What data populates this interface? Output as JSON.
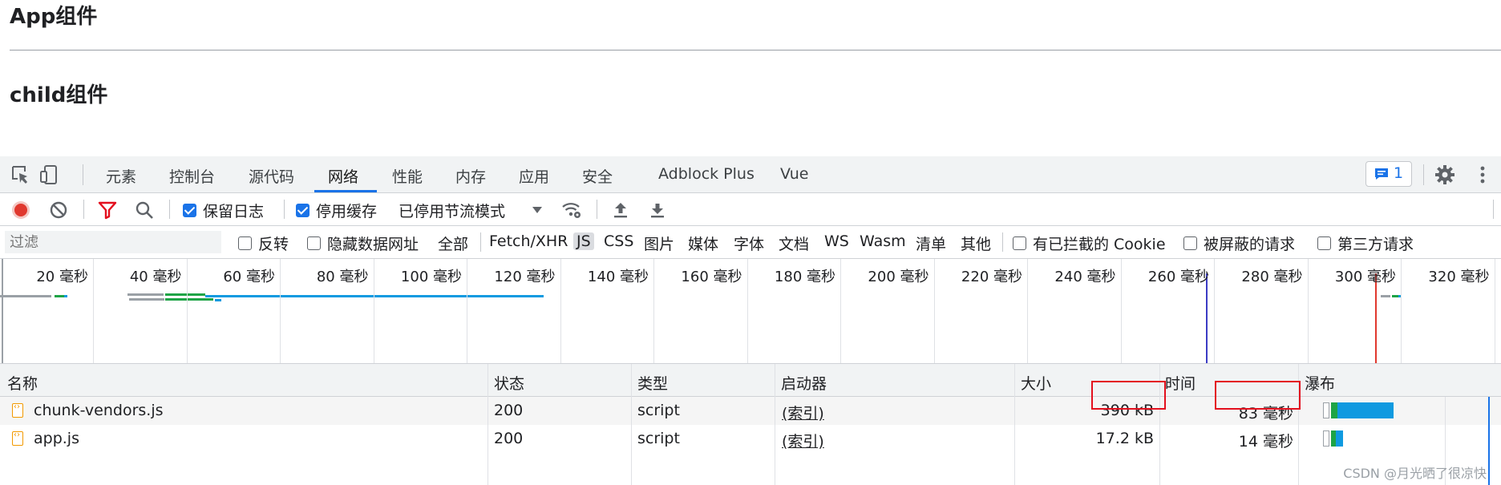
{
  "page": {
    "app_heading": "App组件",
    "child_heading": "child组件"
  },
  "devtools": {
    "tabs": [
      "元素",
      "控制台",
      "源代码",
      "网络",
      "性能",
      "内存",
      "应用",
      "安全",
      "Adblock Plus",
      "Vue"
    ],
    "active_tab": "网络",
    "issues_count": "1",
    "toolbar": {
      "preserve_log": {
        "label": "保留日志",
        "checked": true
      },
      "disable_cache": {
        "label": "停用缓存",
        "checked": true
      },
      "throttling": "已停用节流模式"
    },
    "filter": {
      "placeholder": "过滤",
      "invert_label": "反转",
      "hide_data_urls_label": "隐藏数据网址",
      "types": [
        "全部",
        "Fetch/XHR",
        "JS",
        "CSS",
        "图片",
        "媒体",
        "字体",
        "文档",
        "WS",
        "Wasm",
        "清单",
        "其他"
      ],
      "active_type": "JS",
      "blocked_cookies_label": "有已拦截的 Cookie",
      "blocked_requests_label": "被屏蔽的请求",
      "third_party_label": "第三方请求"
    },
    "timeline": {
      "ticks": [
        "20 毫秒",
        "40 毫秒",
        "60 毫秒",
        "80 毫秒",
        "100 毫秒",
        "120 毫秒",
        "140 毫秒",
        "160 毫秒",
        "180 毫秒",
        "200 毫秒",
        "220 毫秒",
        "240 毫秒",
        "260 毫秒",
        "280 毫秒",
        "300 毫秒",
        "320 毫秒"
      ]
    },
    "table": {
      "columns": [
        "名称",
        "状态",
        "类型",
        "启动器",
        "大小",
        "时间",
        "瀑布"
      ],
      "rows": [
        {
          "name": "chunk-vendors.js",
          "status": "200",
          "type": "script",
          "initiator": "(索引)",
          "size": "390 kB",
          "time": "83 毫秒"
        },
        {
          "name": "app.js",
          "status": "200",
          "type": "script",
          "initiator": "(索引)",
          "size": "17.2 kB",
          "time": "14 毫秒"
        }
      ]
    },
    "colors": {
      "accent": "#1a73e8",
      "record_red": "#e0382e",
      "highlight_red": "#e3101e",
      "waterfall_blue": "#0f9ae0",
      "waterfall_green": "#1ea446"
    }
  },
  "watermark": "CSDN @月光晒了很凉快"
}
